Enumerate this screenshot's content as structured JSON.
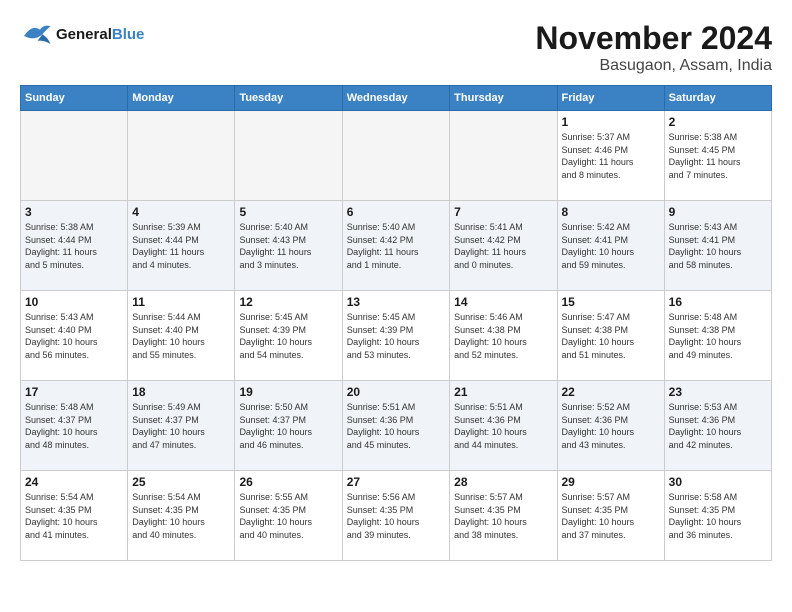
{
  "header": {
    "logo_line1": "General",
    "logo_line2": "Blue",
    "month": "November 2024",
    "location": "Basugaon, Assam, India"
  },
  "weekdays": [
    "Sunday",
    "Monday",
    "Tuesday",
    "Wednesday",
    "Thursday",
    "Friday",
    "Saturday"
  ],
  "weeks": [
    [
      {
        "day": "",
        "info": ""
      },
      {
        "day": "",
        "info": ""
      },
      {
        "day": "",
        "info": ""
      },
      {
        "day": "",
        "info": ""
      },
      {
        "day": "",
        "info": ""
      },
      {
        "day": "1",
        "info": "Sunrise: 5:37 AM\nSunset: 4:46 PM\nDaylight: 11 hours\nand 8 minutes."
      },
      {
        "day": "2",
        "info": "Sunrise: 5:38 AM\nSunset: 4:45 PM\nDaylight: 11 hours\nand 7 minutes."
      }
    ],
    [
      {
        "day": "3",
        "info": "Sunrise: 5:38 AM\nSunset: 4:44 PM\nDaylight: 11 hours\nand 5 minutes."
      },
      {
        "day": "4",
        "info": "Sunrise: 5:39 AM\nSunset: 4:44 PM\nDaylight: 11 hours\nand 4 minutes."
      },
      {
        "day": "5",
        "info": "Sunrise: 5:40 AM\nSunset: 4:43 PM\nDaylight: 11 hours\nand 3 minutes."
      },
      {
        "day": "6",
        "info": "Sunrise: 5:40 AM\nSunset: 4:42 PM\nDaylight: 11 hours\nand 1 minute."
      },
      {
        "day": "7",
        "info": "Sunrise: 5:41 AM\nSunset: 4:42 PM\nDaylight: 11 hours\nand 0 minutes."
      },
      {
        "day": "8",
        "info": "Sunrise: 5:42 AM\nSunset: 4:41 PM\nDaylight: 10 hours\nand 59 minutes."
      },
      {
        "day": "9",
        "info": "Sunrise: 5:43 AM\nSunset: 4:41 PM\nDaylight: 10 hours\nand 58 minutes."
      }
    ],
    [
      {
        "day": "10",
        "info": "Sunrise: 5:43 AM\nSunset: 4:40 PM\nDaylight: 10 hours\nand 56 minutes."
      },
      {
        "day": "11",
        "info": "Sunrise: 5:44 AM\nSunset: 4:40 PM\nDaylight: 10 hours\nand 55 minutes."
      },
      {
        "day": "12",
        "info": "Sunrise: 5:45 AM\nSunset: 4:39 PM\nDaylight: 10 hours\nand 54 minutes."
      },
      {
        "day": "13",
        "info": "Sunrise: 5:45 AM\nSunset: 4:39 PM\nDaylight: 10 hours\nand 53 minutes."
      },
      {
        "day": "14",
        "info": "Sunrise: 5:46 AM\nSunset: 4:38 PM\nDaylight: 10 hours\nand 52 minutes."
      },
      {
        "day": "15",
        "info": "Sunrise: 5:47 AM\nSunset: 4:38 PM\nDaylight: 10 hours\nand 51 minutes."
      },
      {
        "day": "16",
        "info": "Sunrise: 5:48 AM\nSunset: 4:38 PM\nDaylight: 10 hours\nand 49 minutes."
      }
    ],
    [
      {
        "day": "17",
        "info": "Sunrise: 5:48 AM\nSunset: 4:37 PM\nDaylight: 10 hours\nand 48 minutes."
      },
      {
        "day": "18",
        "info": "Sunrise: 5:49 AM\nSunset: 4:37 PM\nDaylight: 10 hours\nand 47 minutes."
      },
      {
        "day": "19",
        "info": "Sunrise: 5:50 AM\nSunset: 4:37 PM\nDaylight: 10 hours\nand 46 minutes."
      },
      {
        "day": "20",
        "info": "Sunrise: 5:51 AM\nSunset: 4:36 PM\nDaylight: 10 hours\nand 45 minutes."
      },
      {
        "day": "21",
        "info": "Sunrise: 5:51 AM\nSunset: 4:36 PM\nDaylight: 10 hours\nand 44 minutes."
      },
      {
        "day": "22",
        "info": "Sunrise: 5:52 AM\nSunset: 4:36 PM\nDaylight: 10 hours\nand 43 minutes."
      },
      {
        "day": "23",
        "info": "Sunrise: 5:53 AM\nSunset: 4:36 PM\nDaylight: 10 hours\nand 42 minutes."
      }
    ],
    [
      {
        "day": "24",
        "info": "Sunrise: 5:54 AM\nSunset: 4:35 PM\nDaylight: 10 hours\nand 41 minutes."
      },
      {
        "day": "25",
        "info": "Sunrise: 5:54 AM\nSunset: 4:35 PM\nDaylight: 10 hours\nand 40 minutes."
      },
      {
        "day": "26",
        "info": "Sunrise: 5:55 AM\nSunset: 4:35 PM\nDaylight: 10 hours\nand 40 minutes."
      },
      {
        "day": "27",
        "info": "Sunrise: 5:56 AM\nSunset: 4:35 PM\nDaylight: 10 hours\nand 39 minutes."
      },
      {
        "day": "28",
        "info": "Sunrise: 5:57 AM\nSunset: 4:35 PM\nDaylight: 10 hours\nand 38 minutes."
      },
      {
        "day": "29",
        "info": "Sunrise: 5:57 AM\nSunset: 4:35 PM\nDaylight: 10 hours\nand 37 minutes."
      },
      {
        "day": "30",
        "info": "Sunrise: 5:58 AM\nSunset: 4:35 PM\nDaylight: 10 hours\nand 36 minutes."
      }
    ]
  ]
}
